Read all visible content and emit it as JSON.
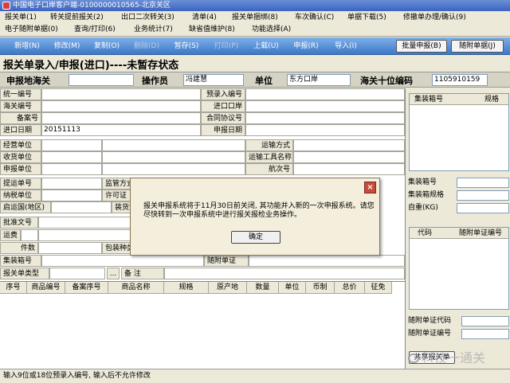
{
  "window": {
    "title": "中国电子口岸客户端-0100000010565-北京关区"
  },
  "menu": {
    "row1": [
      "报关单(1)",
      "转关提前报关(2)",
      "出口二次转关(3)",
      "清单(4)",
      "报关单捆绑(8)",
      "车次确认(C)",
      "单据下载(5)",
      "修撤单办理/确认(9)"
    ],
    "row2": [
      "电子随附单据(0)",
      "查询/打印(6)",
      "业务统计(7)",
      "缺省值维护(8)",
      "功能选择(A)"
    ]
  },
  "toolbar": {
    "buttons": [
      "新增(N)",
      "修改(M)",
      "复制(O)",
      "删除(D)",
      "暂存(S)",
      "打印(P)",
      "上载(U)",
      "申报(R)",
      "导入(I)"
    ],
    "batch_declare": "批量申报(B)",
    "attached_docs": "随附单据(J)"
  },
  "heading": "报关单录入/申报(进口)----未暂存状态",
  "header": {
    "customs_label": "申报地海关",
    "customs_value": "",
    "operator_label": "操作员",
    "operator_value": "冯建慧",
    "unit_label": "单位",
    "unit_value": "东方口岸",
    "code_label": "海关十位编码",
    "code_value": "1105910159"
  },
  "form": {
    "unified_no": "统一编号",
    "customs_no": "海关编号",
    "record_no": "备案号",
    "import_date_label": "进口日期",
    "import_date_value": "20151113",
    "operating_unit": "经营单位",
    "consignee_unit": "收货单位",
    "declare_unit": "申报单位",
    "bill_no": "提运单号",
    "taxpayer_unit": "纳税单位",
    "origin_country": "启运国(地区)",
    "approval_no": "批准文号",
    "freight": "运费",
    "pieces": "件数",
    "container_no": "集装箱号",
    "form_type": "报关单类型",
    "remark": "备    注",
    "ellipsis": "...",
    "pre_entry_no": "预录入编号",
    "entry_port": "进口口岸",
    "contract_no": "合同协议号",
    "declare_date": "申报日期",
    "transport_mode": "运输方式",
    "vessel_name": "运输工具名称",
    "voyage_no": "航次号",
    "regulator": "监管方式",
    "license_no": "许可证",
    "port_of_loading": "装货港",
    "packaging": "包装种类",
    "attached_doc": "随附单证"
  },
  "right_panel": {
    "col_container": "集装箱号",
    "col_spec": "规格",
    "container_no": "集装箱号",
    "container_spec": "集装箱规格",
    "self_weight": "自重(KG)",
    "col_code": "代码",
    "col_attached_no": "随附单证编号",
    "doc_code": "随附单证代码",
    "doc_no": "随附单证编号",
    "shared_btn": "共享报关单"
  },
  "items_table": {
    "columns": [
      "序号",
      "商品编号",
      "备案序号",
      "商品名称",
      "规格",
      "原产地",
      "数量",
      "单位",
      "币制",
      "总价",
      "征免"
    ]
  },
  "status_bar": "输入9位或18位预录入编号, 输入后不允许修改",
  "dialog": {
    "message": "报关申报系统将于11月30日前关闭, 其功能并入新的一次申报系统。请您尽快转到一次申报系统中进行报关报检业务操作。",
    "ok_label": "确定",
    "close_label": "×"
  },
  "watermark": "科技一通关"
}
